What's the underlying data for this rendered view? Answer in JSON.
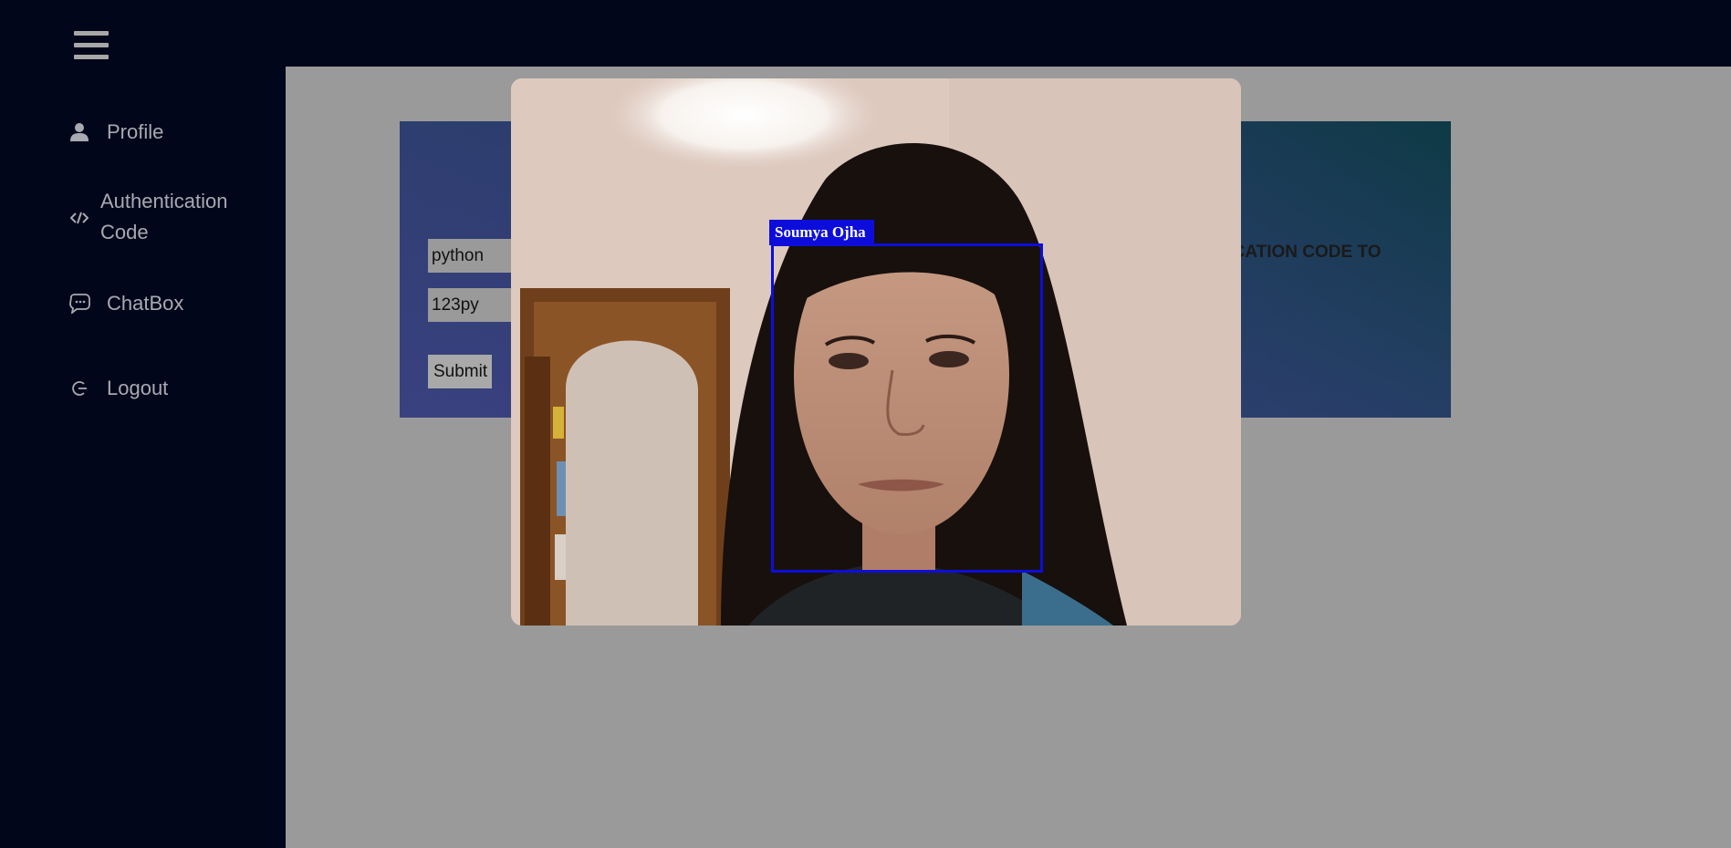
{
  "topbar": {
    "menu_icon": "hamburger-icon"
  },
  "sidebar": {
    "items": [
      {
        "label": "Profile",
        "icon": "user-icon"
      },
      {
        "label": "Authentication Code",
        "icon": "code-icon"
      },
      {
        "label": "ChatBox",
        "icon": "chat-icon"
      },
      {
        "label": "Logout",
        "icon": "logout-icon"
      }
    ]
  },
  "form": {
    "username_value": "python",
    "password_value": "123py",
    "submit_label": "Submit",
    "heading_visible_part": "NTICATION CODE TO"
  },
  "camera": {
    "detected_name": "Soumya Ojha",
    "box_color": "#0d0ddb"
  },
  "colors": {
    "sidebar_bg": "#02061a",
    "main_bg": "#9a9a9a",
    "text_muted": "#a9a9b2"
  }
}
